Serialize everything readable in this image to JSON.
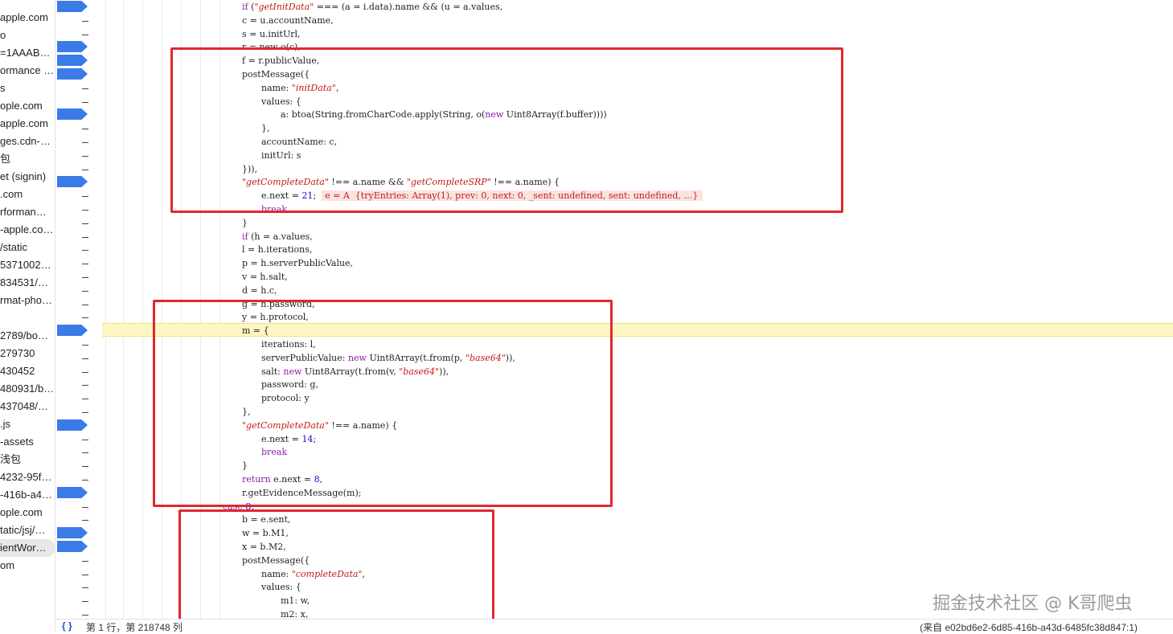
{
  "sidebar": {
    "files": [
      {
        "label": "apple.com",
        "selected": false
      },
      {
        "label": "o",
        "selected": false
      },
      {
        "label": "=1AAAB…",
        "selected": false
      },
      {
        "label": "ormance …",
        "selected": false
      },
      {
        "label": "s",
        "selected": false
      },
      {
        "label": "ople.com",
        "selected": false
      },
      {
        "label": "apple.com",
        "selected": false
      },
      {
        "label": "ges.cdn-…",
        "selected": false
      },
      {
        "label": "包",
        "selected": false
      },
      {
        "label": "et (signin)",
        "selected": false
      },
      {
        "label": ".com",
        "selected": false
      },
      {
        "label": "rforman…",
        "selected": false
      },
      {
        "label": "-apple.co…",
        "selected": false
      },
      {
        "label": "/static",
        "selected": false
      },
      {
        "label": "5371002…",
        "selected": false
      },
      {
        "label": "834531/…",
        "selected": false
      },
      {
        "label": "rmat-pho…",
        "selected": false
      },
      {
        "label": "",
        "selected": false
      },
      {
        "label": "2789/bo…",
        "selected": false
      },
      {
        "label": "279730",
        "selected": false
      },
      {
        "label": "430452",
        "selected": false
      },
      {
        "label": "480931/b…",
        "selected": false
      },
      {
        "label": "437048/…",
        "selected": false
      },
      {
        "label": ".js",
        "selected": false
      },
      {
        "label": "-assets",
        "selected": false
      },
      {
        "label": "浅包",
        "selected": false
      },
      {
        "label": "4232-95f…",
        "selected": false
      },
      {
        "label": "-416b-a4…",
        "selected": false
      },
      {
        "label": "ople.com",
        "selected": false
      },
      {
        "label": "tatic/jsj/…",
        "selected": false
      },
      {
        "label": "ientWor…",
        "selected": true
      },
      {
        "label": "om",
        "selected": false
      }
    ]
  },
  "code": {
    "lines": [
      {
        "indent": 0,
        "tokens": [
          [
            "kw",
            "if"
          ],
          [
            "t",
            " ("
          ],
          [
            "str",
            "\"getInitData\""
          ],
          [
            "t",
            " === (a = i.data).name && (u = a.values,"
          ]
        ]
      },
      {
        "indent": 0,
        "tokens": [
          [
            "t",
            "c = u.accountName,"
          ]
        ]
      },
      {
        "indent": 0,
        "tokens": [
          [
            "t",
            "s = u.initUrl,"
          ]
        ]
      },
      {
        "indent": 0,
        "tokens": [
          [
            "t",
            "r = new o(c),"
          ]
        ]
      },
      {
        "indent": 0,
        "tokens": [
          [
            "t",
            "f = r.publicValue,"
          ]
        ]
      },
      {
        "indent": 0,
        "tokens": [
          [
            "t",
            "postMessage({"
          ]
        ]
      },
      {
        "indent": 1,
        "tokens": [
          [
            "t",
            "name: "
          ],
          [
            "str",
            "\"initData\""
          ],
          [
            "t",
            ","
          ]
        ]
      },
      {
        "indent": 1,
        "tokens": [
          [
            "t",
            "values: {"
          ]
        ]
      },
      {
        "indent": 2,
        "tokens": [
          [
            "t",
            "a: btoa(String.fromCharCode.apply(String, o("
          ],
          [
            "kw",
            "new"
          ],
          [
            "t",
            " Uint8Array(f.buffer))))"
          ]
        ]
      },
      {
        "indent": 1,
        "tokens": [
          [
            "t",
            "},"
          ]
        ]
      },
      {
        "indent": 1,
        "tokens": [
          [
            "t",
            "accountName: c,"
          ]
        ]
      },
      {
        "indent": 1,
        "tokens": [
          [
            "t",
            "initUrl: s"
          ]
        ]
      },
      {
        "indent": 0,
        "tokens": [
          [
            "t",
            "})),"
          ]
        ]
      },
      {
        "indent": 0,
        "tokens": [
          [
            "str",
            "\"getCompleteData\""
          ],
          [
            "t",
            " !== a.name && "
          ],
          [
            "str",
            "\"getCompleteSRP\""
          ],
          [
            "t",
            " !== a.name) {"
          ]
        ]
      },
      {
        "indent": 1,
        "tokens": [
          [
            "t",
            "e.next = "
          ],
          [
            "num",
            "21"
          ],
          [
            "t",
            ";  "
          ],
          [
            "inline",
            "e = A  {tryEntries: Array(1), prev: 0, next: 0, _sent: undefined, sent: undefined, …}"
          ]
        ]
      },
      {
        "indent": 1,
        "tokens": [
          [
            "kw",
            "break"
          ]
        ]
      },
      {
        "indent": 0,
        "tokens": [
          [
            "t",
            "}"
          ]
        ]
      },
      {
        "indent": 0,
        "tokens": [
          [
            "kw",
            "if"
          ],
          [
            "t",
            " (h = a.values,"
          ]
        ]
      },
      {
        "indent": 0,
        "tokens": [
          [
            "t",
            "l = h.iterations,"
          ]
        ]
      },
      {
        "indent": 0,
        "tokens": [
          [
            "t",
            "p = h.serverPublicValue,"
          ]
        ]
      },
      {
        "indent": 0,
        "tokens": [
          [
            "t",
            "v = h.salt,"
          ]
        ]
      },
      {
        "indent": 0,
        "tokens": [
          [
            "t",
            "d = h.c,"
          ]
        ]
      },
      {
        "indent": 0,
        "tokens": [
          [
            "t",
            "g = h.password,"
          ]
        ]
      },
      {
        "indent": 0,
        "tokens": [
          [
            "t",
            "y = h.protocol,"
          ]
        ]
      },
      {
        "indent": 0,
        "tokens": [
          [
            "t",
            "m = {"
          ]
        ]
      },
      {
        "indent": 1,
        "tokens": [
          [
            "t",
            "iterations: l,"
          ]
        ]
      },
      {
        "indent": 1,
        "tokens": [
          [
            "t",
            "serverPublicValue: "
          ],
          [
            "kw",
            "new"
          ],
          [
            "t",
            " Uint8Array(t.from(p, "
          ],
          [
            "str",
            "\"base64\""
          ],
          [
            "t",
            ")),"
          ]
        ]
      },
      {
        "indent": 1,
        "tokens": [
          [
            "t",
            "salt: "
          ],
          [
            "kw",
            "new"
          ],
          [
            "t",
            " Uint8Array(t.from(v, "
          ],
          [
            "str",
            "\"base64\""
          ],
          [
            "t",
            ")),"
          ]
        ]
      },
      {
        "indent": 1,
        "tokens": [
          [
            "t",
            "password: g,"
          ]
        ]
      },
      {
        "indent": 1,
        "tokens": [
          [
            "t",
            "protocol: y"
          ]
        ]
      },
      {
        "indent": 0,
        "tokens": [
          [
            "t",
            "},"
          ]
        ]
      },
      {
        "indent": 0,
        "tokens": [
          [
            "str",
            "\"getCompleteData\""
          ],
          [
            "t",
            " !== a.name) {"
          ]
        ]
      },
      {
        "indent": 1,
        "tokens": [
          [
            "t",
            "e.next = "
          ],
          [
            "num",
            "14"
          ],
          [
            "t",
            ";"
          ]
        ]
      },
      {
        "indent": 1,
        "tokens": [
          [
            "kw",
            "break"
          ]
        ]
      },
      {
        "indent": 0,
        "tokens": [
          [
            "t",
            "}"
          ]
        ]
      },
      {
        "indent": 0,
        "tokens": [
          [
            "kw",
            "return"
          ],
          [
            "t",
            " e.next = "
          ],
          [
            "num",
            "8"
          ],
          [
            "t",
            ","
          ]
        ]
      },
      {
        "indent": 0,
        "tokens": [
          [
            "t",
            "r.getEvidenceMessage(m);"
          ]
        ]
      },
      {
        "indent": -1,
        "tokens": [
          [
            "kw",
            "case"
          ],
          [
            "t",
            " "
          ],
          [
            "num",
            "8"
          ],
          [
            "t",
            ":"
          ]
        ]
      },
      {
        "indent": 0,
        "tokens": [
          [
            "t",
            "b = e.sent,"
          ]
        ]
      },
      {
        "indent": 0,
        "tokens": [
          [
            "t",
            "w = b.M1,"
          ]
        ]
      },
      {
        "indent": 0,
        "tokens": [
          [
            "t",
            "x = b.M2,"
          ]
        ]
      },
      {
        "indent": 0,
        "tokens": [
          [
            "t",
            "postMessage({"
          ]
        ]
      },
      {
        "indent": 1,
        "tokens": [
          [
            "t",
            "name: "
          ],
          [
            "str",
            "\"completeData\""
          ],
          [
            "t",
            ","
          ]
        ]
      },
      {
        "indent": 1,
        "tokens": [
          [
            "t",
            "values: {"
          ]
        ]
      },
      {
        "indent": 2,
        "tokens": [
          [
            "t",
            "m1: w,"
          ]
        ]
      },
      {
        "indent": 2,
        "tokens": [
          [
            "t",
            "m2: x,"
          ]
        ]
      }
    ],
    "breakpoint_lines": [
      0,
      3,
      4,
      5,
      8,
      13,
      24,
      31,
      36,
      39,
      40
    ],
    "current_line": 24
  },
  "status": {
    "braces_icon": "{ }",
    "position": "第 1 行，第 218748 列",
    "source": "(来自 e02bd6e2-6d85-416b-a43d-6485fc38d847:1)"
  },
  "watermark": "掘金技术社区 @ K哥爬虫",
  "colors": {
    "breakpoint": "#3b7be8",
    "highlight": "#fdf6c3",
    "annotation_box": "#e0282e"
  }
}
